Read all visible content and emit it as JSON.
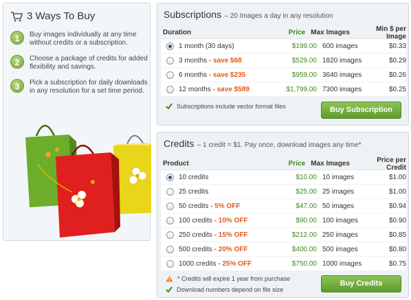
{
  "left": {
    "title": "3 Ways To Buy",
    "steps": [
      {
        "num": "1",
        "text": "Buy images individually at any time without credits or a subscription."
      },
      {
        "num": "2",
        "text": "Choose a package of credits for added flexibility and savings."
      },
      {
        "num": "3",
        "text": "Pick a subscription for daily downloads in any resolution for a set time period."
      }
    ]
  },
  "subscriptions": {
    "title": "Subscriptions",
    "subtitle": "– 20 Images a day in any resolution",
    "headers": {
      "duration": "Duration",
      "price": "Price",
      "max": "Max Images",
      "min": "Min $ per Image"
    },
    "rows": [
      {
        "name": "1 month (30 days)",
        "save": "",
        "price": "$199.00",
        "max": "600 images",
        "min": "$0.33",
        "selected": true
      },
      {
        "name": "3 months",
        "save": "- save $68",
        "price": "$529.00",
        "max": "1820 images",
        "min": "$0.29",
        "selected": false
      },
      {
        "name": "6 months",
        "save": "- save $235",
        "price": "$959.00",
        "max": "3640 images",
        "min": "$0.26",
        "selected": false
      },
      {
        "name": "12 months",
        "save": "- save $589",
        "price": "$1,799.00",
        "max": "7300 images",
        "min": "$0.25",
        "selected": false
      }
    ],
    "note": "Subscriptions include vector format files",
    "button": "Buy Subscription"
  },
  "credits": {
    "title": "Credits",
    "subtitle": "– 1 credit = $1. Pay once, download images any time*",
    "headers": {
      "product": "Product",
      "price": "Price",
      "max": "Max Images",
      "per": "Price per Credit"
    },
    "rows": [
      {
        "name": "10 credits",
        "save": "",
        "price": "$10.00",
        "max": "10 images",
        "per": "$1.00",
        "selected": true
      },
      {
        "name": "25 credits",
        "save": "",
        "price": "$25.00",
        "max": "25 images",
        "per": "$1.00",
        "selected": false
      },
      {
        "name": "50 credits",
        "save": "- 5% OFF",
        "price": "$47.00",
        "max": "50 images",
        "per": "$0.94",
        "selected": false
      },
      {
        "name": "100 credits",
        "save": "- 10% OFF",
        "price": "$90.00",
        "max": "100 images",
        "per": "$0.90",
        "selected": false
      },
      {
        "name": "250 credits",
        "save": "- 15% OFF",
        "price": "$212.00",
        "max": "250 images",
        "per": "$0.85",
        "selected": false
      },
      {
        "name": "500 credits",
        "save": "- 20% OFF",
        "price": "$400.00",
        "max": "500 images",
        "per": "$0.80",
        "selected": false
      },
      {
        "name": "1000 credits",
        "save": "- 25% OFF",
        "price": "$750.00",
        "max": "1000 images",
        "per": "$0.75",
        "selected": false
      }
    ],
    "note_expire": "* Credits will expire 1 year from purchase",
    "note_size": "Download numbers depend on file size",
    "button": "Buy Credits"
  },
  "colors": {
    "accent_green": "#5e9b2f",
    "price_green": "#3a8a1d",
    "save_orange": "#e05a1c"
  },
  "icons": [
    "cart-icon",
    "check-icon",
    "warning-icon"
  ]
}
